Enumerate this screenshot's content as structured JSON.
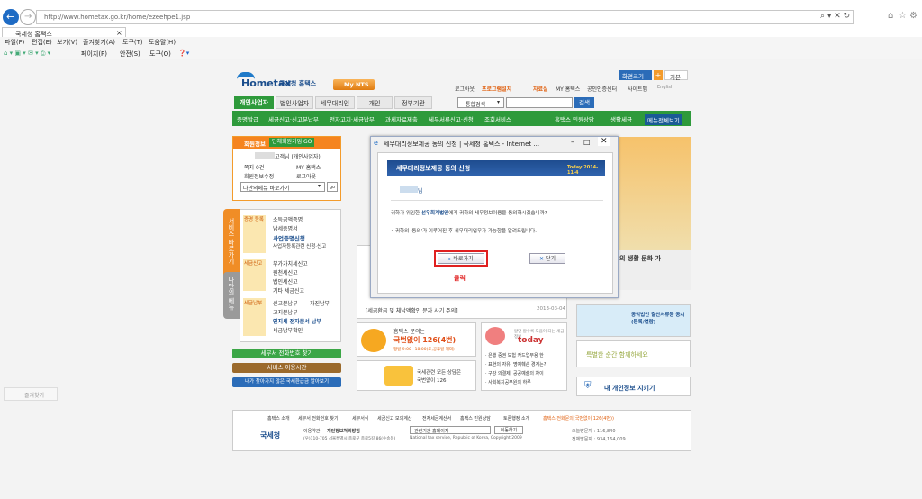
{
  "browser": {
    "url": "http://www.hometax.go.kr/home/ezeehpe1.jsp",
    "tab_title": "국세청 홈택스",
    "menu": [
      "파일(F)",
      "편집(E)",
      "보기(V)",
      "즐겨찾기(A)",
      "도구(T)",
      "도움말(H)"
    ],
    "cmd": [
      "페이지(P)",
      "안전(S)",
      "도구(O)"
    ],
    "side_panel": "즐겨찾기"
  },
  "site": {
    "logo": "Hometax",
    "logo_sub": "국세청 홈택스",
    "my_nts": "My NTS",
    "screen_size": "화면크기",
    "plus": "+",
    "basic": "기본",
    "top_links": [
      "로그아웃",
      "프로그램설치",
      "자료실",
      "MY 홈택스",
      "공인인증센터",
      "사이트맵",
      "English",
      "생활세금"
    ],
    "gnb": [
      "개인사업자",
      "법인사업자",
      "세무대리인",
      "개인",
      "정부기관"
    ],
    "search_select": "통합검색",
    "search_btn": "검색",
    "subnav": [
      "증명발급",
      "세금신고·신고분납부",
      "전자고지·세금납부",
      "과세자료제출",
      "세무서류신고·신청",
      "조회서비스"
    ],
    "subnav_right": [
      "홈택스 민원상담",
      "생활세금",
      "메뉴전체보기"
    ],
    "member": {
      "header": "회원정보",
      "change_btn": "단체회원가입 GO",
      "user": "고객님 (개인사업자)",
      "items": [
        "쪽지 0건",
        "MY 홈택스",
        "회원정보수정",
        "로그아웃"
      ],
      "menu_select": "나만의메뉴 바로가기",
      "go": "go"
    },
    "services": {
      "tab_main": "서비스 바로가기",
      "tab_mine": "나만의 메뉴",
      "groups": [
        {
          "label": "증명 등록",
          "items": [
            "소득금액증명",
            "납세증명서",
            "사업증명신청",
            "사업자등록관련 신청·신고"
          ]
        },
        {
          "label": "세금신고",
          "items": [
            "부가가치세신고",
            "원천세신고",
            "법인세신고",
            "기타 세금신고"
          ]
        },
        {
          "label": "세금납부",
          "items": [
            "신고분납부",
            "자진납부",
            "고지분납부",
            "인지세 전자문서 납부",
            "세금납부확인"
          ]
        }
      ]
    },
    "btns": [
      "세무서 전화번호 찾기",
      "서비스 이용시간",
      "내가 찾아가지 않은 국세환급금 알아보기"
    ],
    "notice": [
      "[세금환급 및 체납액확인 문자 사기 주의]",
      "2013-03-04"
    ],
    "call": {
      "label": "홈택스 문의는",
      "num": "국번없이 126(4번)",
      "hours": "평일 9:00~18:00(토,공휴일 제외)"
    },
    "call2": {
      "label": "국세관련 모든 상담은",
      "num": "국번없이 126"
    },
    "today": {
      "title": "today",
      "sub": "알면 알수록 도움이 되는 세금정보",
      "items": [
        "· 은행 중권 보험 카드업무용 한",
        "· 표현의 자유, 명예훼손 경계는?",
        "· 구강 의결제, 공공예술의 차이",
        "· 사회복지공무원의 하루"
      ]
    },
    "right": {
      "banner_text": "의 생활 문화 가",
      "award": "공익법인 결산서류등 공시 (등록/열람)",
      "slogan": "특별한 순간 함께하세요",
      "privacy": "내 개인정보 지키기"
    },
    "footer": {
      "links": [
        "홈택스 소개",
        "세무서 전화번호 찾기",
        "세무서식",
        "세금신고 모의계산",
        "전자세금계산서",
        "홈택스 민원상담",
        "토론행정 소개",
        "홈택스 전화문의(국번없이 126(4번))"
      ],
      "org": "국세청",
      "addr1": "이용약관",
      "addr2": "개인정보처리방침",
      "addr3": "(우)110-705 서울특별시 종로구 종로5길 86(수송동)",
      "copy": "National tax service, Republic of Korea, Copyright 2009",
      "select": "관련기관 홈페이지",
      "move": "이동하기",
      "visits": [
        "오늘방문자 : 116,840",
        "전체방문자 : 934,164,009"
      ]
    }
  },
  "popup": {
    "title": "세무대리정보제공 동의 신청 | 국세청 홈택스 - Internet ...",
    "header": "세무대리정보제공 동의 신청",
    "today": "Today:2014-11-4",
    "name": "님",
    "line1a": "귀하가 위임한 ",
    "line1b": "선우회계법인",
    "line1c": "에게 귀하의 세무정보이용을 동의하시겠습니까?",
    "line2": "• 귀하의 '동의'가 이루어진 후 세무대리업무가 가능함을 알려드립니다.",
    "go_btn": "바로가기",
    "close_btn": "닫기",
    "click_label": "클릭"
  }
}
